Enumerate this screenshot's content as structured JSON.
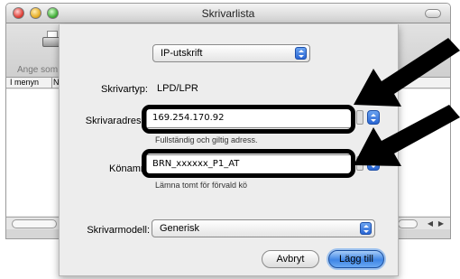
{
  "window": {
    "title": "Skrivarlista",
    "toolbar_label": "Ange som",
    "list_columns": [
      "I menyn",
      "N"
    ]
  },
  "sheet": {
    "protocol_popup": "IP-utskrift",
    "printer_type_label": "Skrivartyp:",
    "printer_type_value": "LPD/LPR",
    "address_label": "Skrivaradress",
    "address_value": "169.254.170.92",
    "address_hint": "Fullständig och giltig adress.",
    "queue_label": "Könamn",
    "queue_value": "BRN_xxxxxx_P1_AT",
    "queue_hint": "Lämna tomt för förvald kö",
    "model_label": "Skrivarmodell:",
    "model_value": "Generisk",
    "cancel_button": "Avbryt",
    "add_button": "Lägg till"
  },
  "colors": {
    "accent": "#3f86e6",
    "highlight": "#000000"
  }
}
